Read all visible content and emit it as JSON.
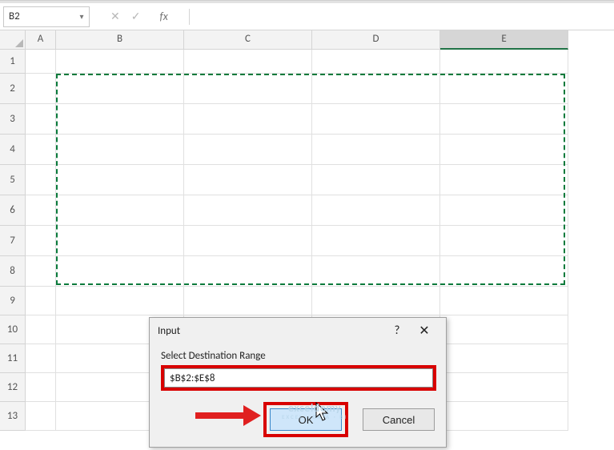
{
  "namebox": {
    "value": "B2"
  },
  "formula_bar": {
    "fx_label": "fx"
  },
  "columns": {
    "A": "A",
    "B": "B",
    "C": "C",
    "D": "D",
    "E": "E"
  },
  "rows": [
    "1",
    "2",
    "3",
    "4",
    "5",
    "6",
    "7",
    "8",
    "9",
    "10",
    "11",
    "12",
    "13"
  ],
  "dialog": {
    "title": "Input",
    "prompt": "Select Destination Range",
    "value": "$B$2:$E$8",
    "ok": "OK",
    "cancel": "Cancel",
    "help": "?",
    "close": "✕"
  },
  "watermark": {
    "brand": "exceldemy",
    "sub": "EXCEL · DATA · BI"
  },
  "annotation": {
    "highlight_input": true,
    "highlight_ok": true
  }
}
